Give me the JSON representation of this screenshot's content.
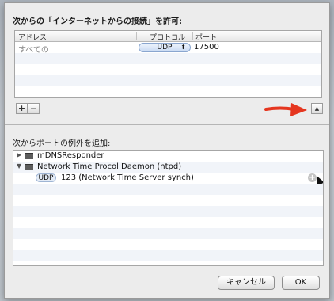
{
  "background": {
    "ghost_text": "インターネットからの接続"
  },
  "incoming": {
    "title": "次からの「インターネットからの接続」を許可:",
    "columns": [
      "アドレス",
      "プロトコル",
      "ポート"
    ],
    "rows": [
      {
        "app": "すべての",
        "protocol": "UDP",
        "protocol_arrows": "⬍",
        "port": "17500"
      }
    ]
  },
  "table_controls": {
    "add_label": "+",
    "remove_label": "−",
    "disclosure_label": "▲"
  },
  "annotation": {
    "arrow_color": "#e5361f"
  },
  "exceptions": {
    "title": "次からポートの例外を追加:",
    "items": [
      {
        "expand_icon": "▶",
        "label": "mDNSResponder"
      },
      {
        "expand_icon": "▼",
        "label": "Network Time Procol Daemon (ntpd)"
      }
    ],
    "child": {
      "tag": "UDP",
      "label": "123 (Network Time Server synch)",
      "add_icon": "+"
    }
  },
  "buttons": {
    "cancel": "キャンセル",
    "ok": "OK"
  }
}
